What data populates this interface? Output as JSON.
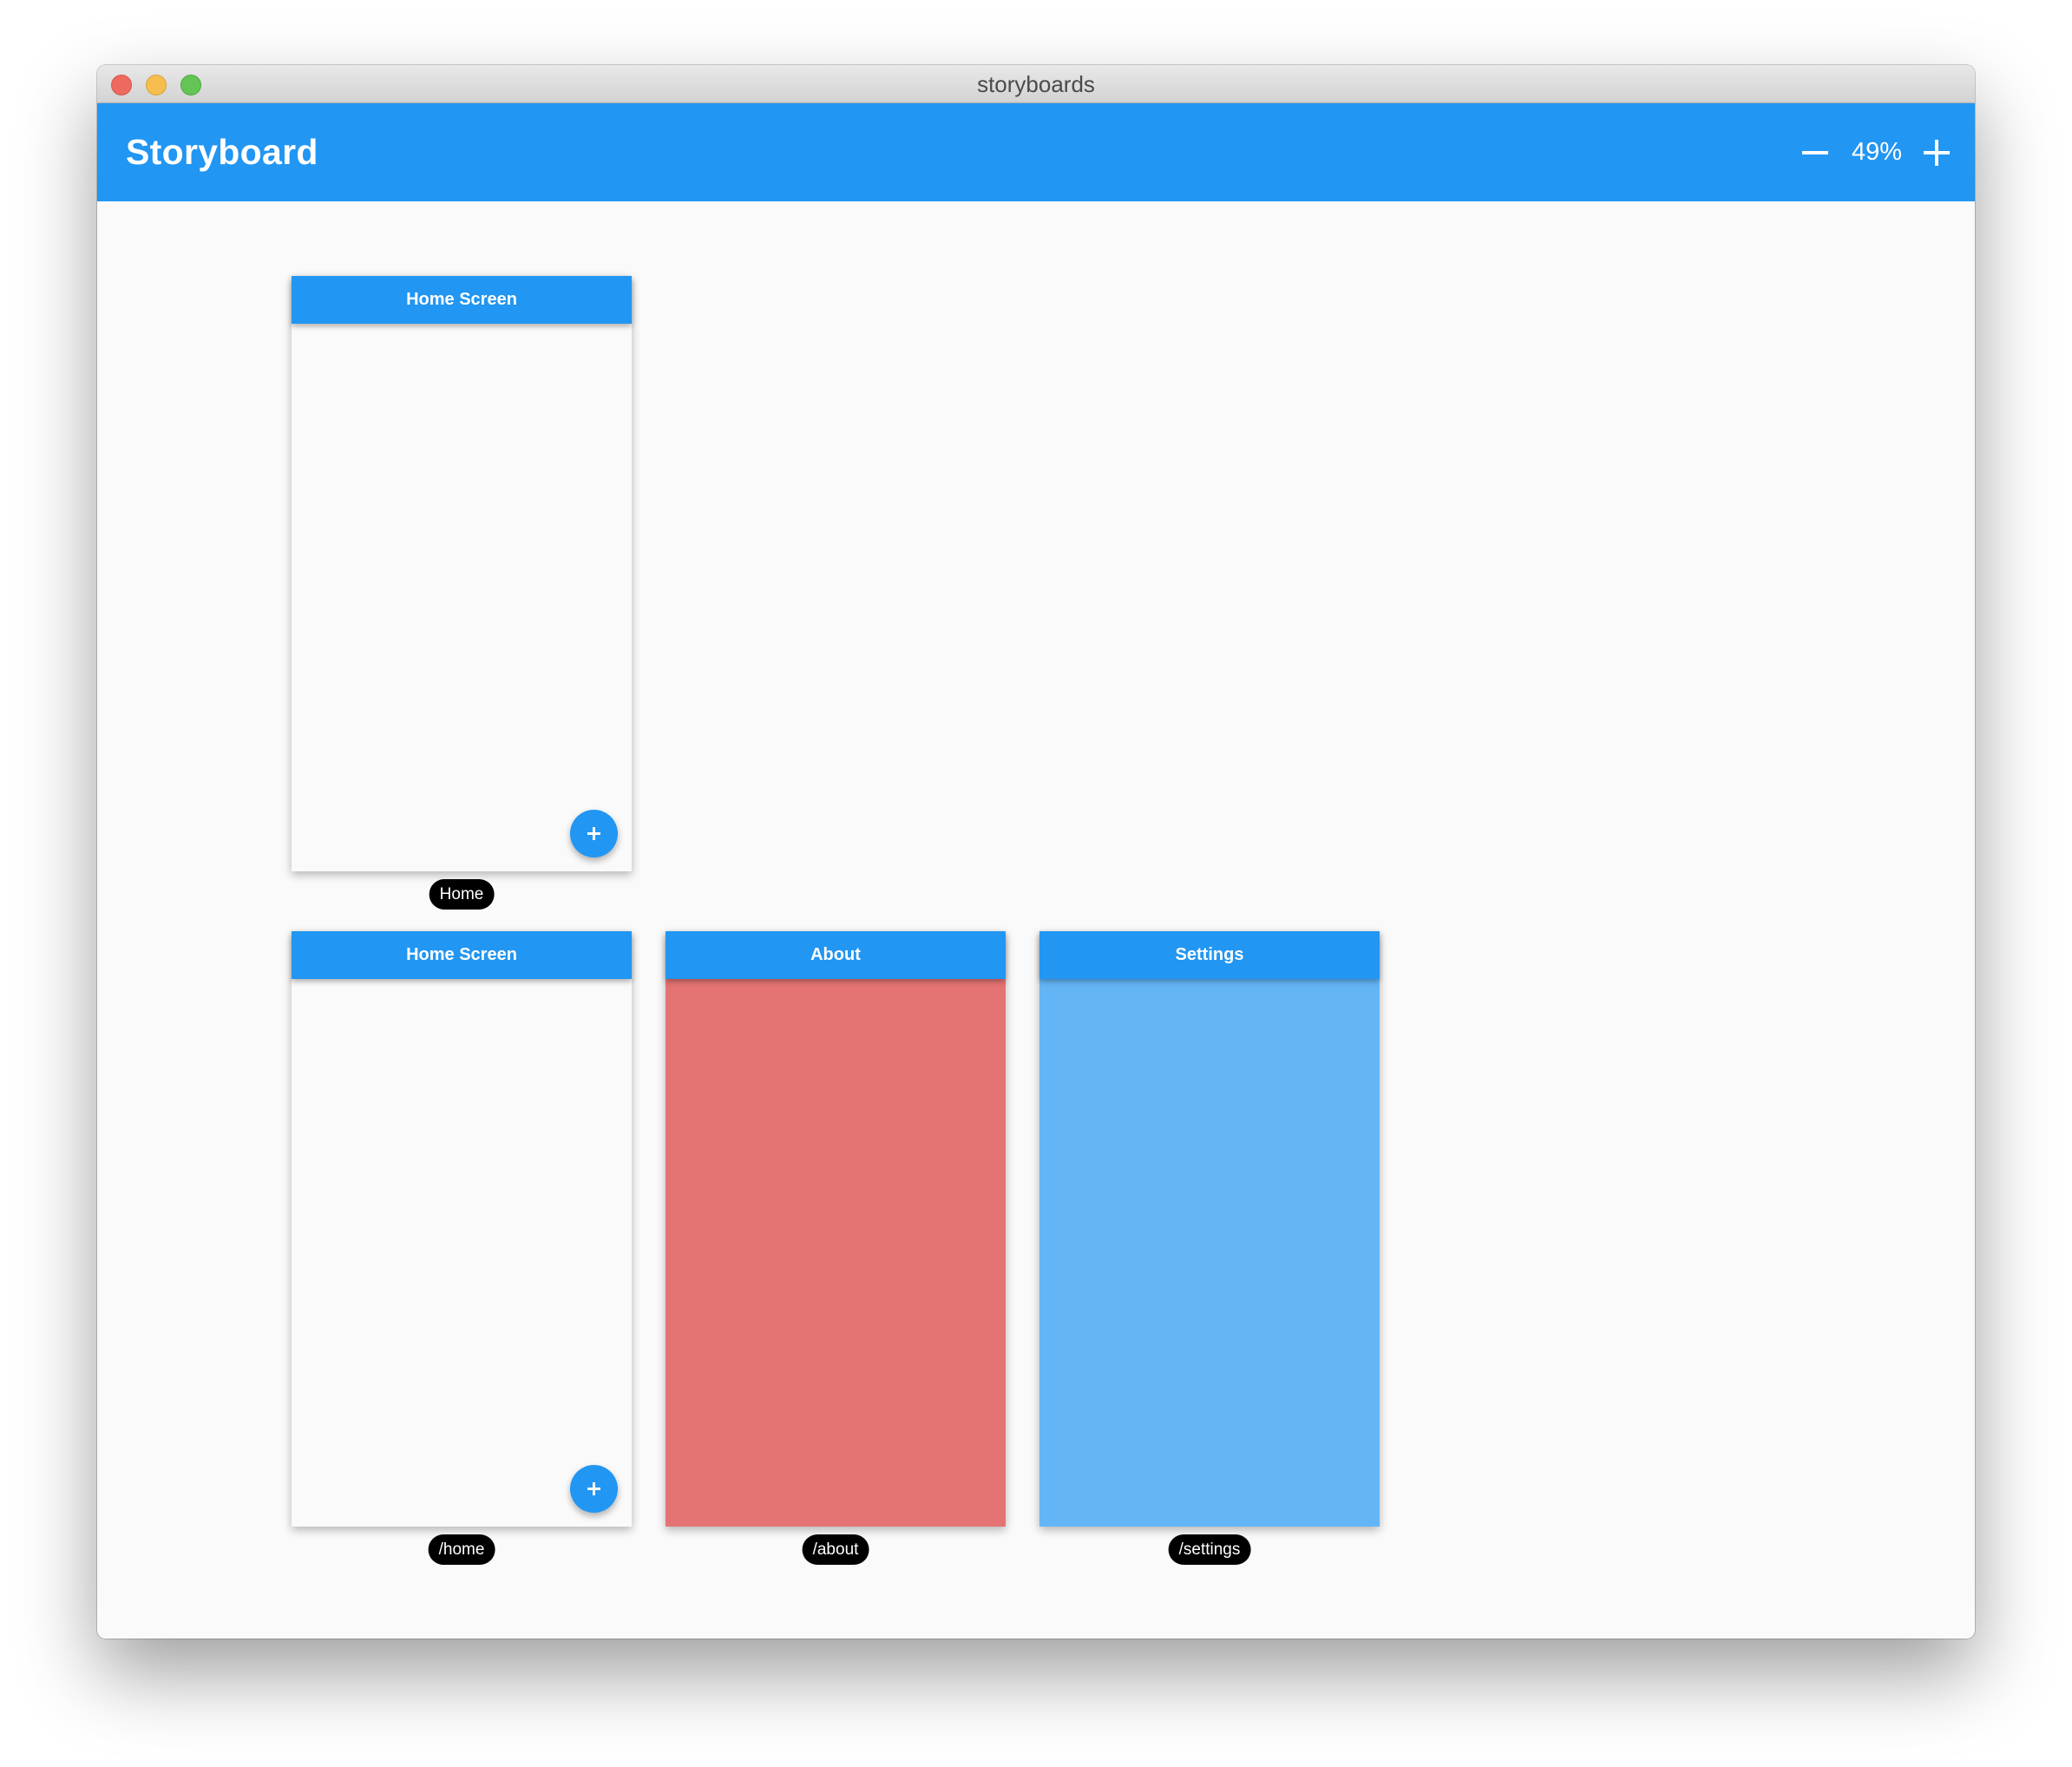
{
  "window": {
    "title": "storyboards",
    "controls": [
      "close",
      "minimize",
      "zoom"
    ]
  },
  "appbar": {
    "title": "Storyboard",
    "zoom_out_icon": "minus-icon",
    "zoom_level": "49%",
    "zoom_in_icon": "plus-icon"
  },
  "colors": {
    "primary": "#2196F3",
    "canvas_background": "#FAFAFA",
    "about_body": "#E57373",
    "settings_body": "#64B5F6",
    "label_background": "#000000"
  },
  "screens": [
    {
      "header": "Home Screen",
      "label": "Home",
      "body_color": "#FAFAFA",
      "has_fab": true,
      "fab_icon": "plus-icon"
    },
    {
      "header": "Home Screen",
      "label": "/home",
      "body_color": "#FAFAFA",
      "has_fab": true,
      "fab_icon": "plus-icon"
    },
    {
      "header": "About",
      "label": "/about",
      "body_color": "#E57373",
      "has_fab": false
    },
    {
      "header": "Settings",
      "label": "/settings",
      "body_color": "#64B5F6",
      "has_fab": false
    }
  ]
}
